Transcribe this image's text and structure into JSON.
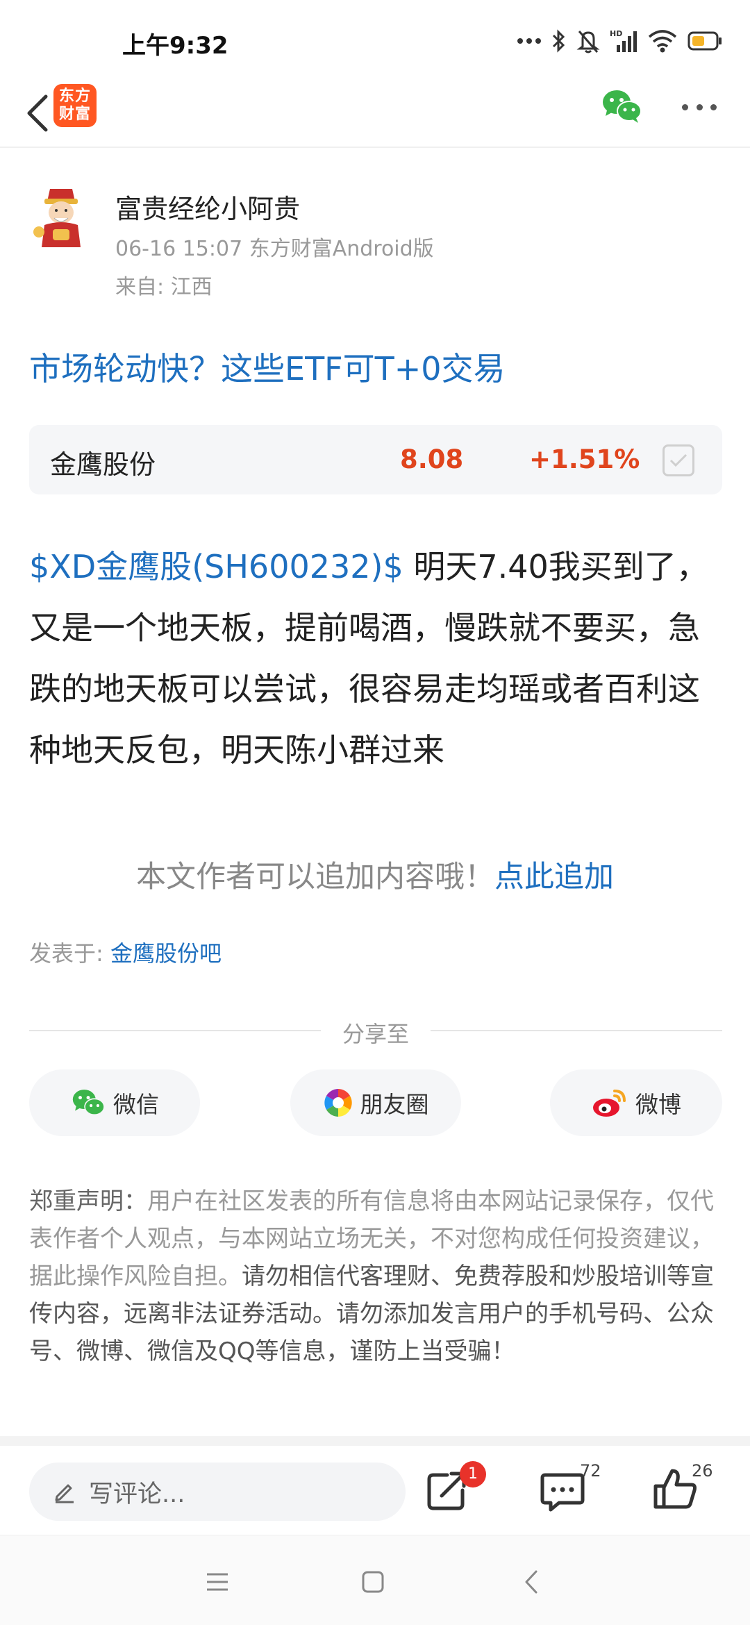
{
  "status_bar": {
    "time": "上午9:32",
    "battery_color": "#f5b428"
  },
  "header": {
    "logo_line1": "东方",
    "logo_line2": "财富",
    "brand_color": "#ff5722"
  },
  "author": {
    "name": "富贵经纶小阿贵",
    "meta": "06-16 15:07 东方财富Android版",
    "from": "来自: 江西"
  },
  "post": {
    "title": "市场轮动快？这些ETF可T+0交易",
    "stock_link": "$XD金鹰股(SH600232)$",
    "body": " 明天7.40我买到了，又是一个地天板，提前喝酒，慢跌就不要买，急跌的地天板可以尝试，很容易走均瑶或者百利这种地天反包，明天陈小群过来"
  },
  "stock_card": {
    "name": "金鹰股份",
    "price": "8.08",
    "change": "+1.51%",
    "up_color": "#e0451d"
  },
  "append": {
    "prompt": "本文作者可以追加内容哦！",
    "link": "点此追加"
  },
  "posted_in": {
    "label": "发表于: ",
    "bar": "金鹰股份吧"
  },
  "share": {
    "label": "分享至",
    "wechat": "微信",
    "moments": "朋友圈",
    "weibo": "微博"
  },
  "disclaimer": {
    "title": "郑重声明：",
    "text_gray": "用户在社区发表的所有信息将由本网站记录保存，仅代表作者个人观点，与本网站立场无关，不对您构成任何投资建议，据此操作风险自担。",
    "text_dark": "请勿相信代客理财、免费荐股和炒股培训等宣传内容，远离非法证券活动。请勿添加发言用户的手机号码、公众号、微博、微信及QQ等信息，谨防上当受骗！"
  },
  "action_bar": {
    "comment_placeholder": "写评论...",
    "share_badge": "1",
    "comment_count": "72",
    "like_count": "26"
  },
  "icons": {
    "back": "chevron-left-icon",
    "wechat": "wechat-icon",
    "more": "more-dots-icon",
    "moments": "moments-aperture-icon",
    "weibo": "weibo-icon",
    "pencil": "pencil-icon",
    "share": "share-out-icon",
    "comment": "comment-bubble-icon",
    "like": "thumbs-up-icon"
  },
  "colors": {
    "link": "#1e6fbf",
    "wechat_green": "#3bb54a",
    "weibo_red": "#e6162d",
    "badge_red": "#e8322a"
  }
}
